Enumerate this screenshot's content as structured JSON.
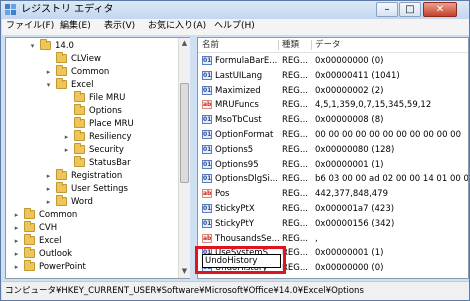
{
  "window": {
    "title": "レジストリ エディタ"
  },
  "menu": [
    "ファイル(F)",
    "編集(E)",
    "表示(V)",
    "お気に入り(A)",
    "ヘルプ(H)"
  ],
  "tree": [
    {
      "label": "14.0",
      "depth": 0,
      "expander": "minus"
    },
    {
      "label": "CLView",
      "depth": 1,
      "expander": ""
    },
    {
      "label": "Common",
      "depth": 1,
      "expander": "plus"
    },
    {
      "label": "Excel",
      "depth": 1,
      "expander": "minus"
    },
    {
      "label": "File MRU",
      "depth": 2,
      "expander": ""
    },
    {
      "label": "Options",
      "depth": 2,
      "expander": ""
    },
    {
      "label": "Place MRU",
      "depth": 2,
      "expander": ""
    },
    {
      "label": "Resiliency",
      "depth": 2,
      "expander": "plus"
    },
    {
      "label": "Security",
      "depth": 2,
      "expander": "plus"
    },
    {
      "label": "StatusBar",
      "depth": 2,
      "expander": ""
    },
    {
      "label": "Registration",
      "depth": 1,
      "expander": "plus"
    },
    {
      "label": "User Settings",
      "depth": 1,
      "expander": "plus"
    },
    {
      "label": "Word",
      "depth": 1,
      "expander": "plus"
    },
    {
      "label": "Common",
      "depth": -1,
      "expander": "plus"
    },
    {
      "label": "CVH",
      "depth": -1,
      "expander": "plus"
    },
    {
      "label": "Excel",
      "depth": -1,
      "expander": "plus"
    },
    {
      "label": "Outlook",
      "depth": -1,
      "expander": "plus"
    },
    {
      "label": "PowerPoint",
      "depth": -1,
      "expander": "plus"
    }
  ],
  "list": {
    "headers": [
      "名前",
      "種類",
      "データ"
    ],
    "rows": [
      {
        "name": "FormulaBarE...",
        "type": "REG...",
        "data": "0x00000000 (0)",
        "icon": "bin"
      },
      {
        "name": "LastUILang",
        "type": "REG...",
        "data": "0x00000411 (1041)",
        "icon": "bin"
      },
      {
        "name": "Maximized",
        "type": "REG...",
        "data": "0x00000002 (2)",
        "icon": "bin"
      },
      {
        "name": "MRUFuncs",
        "type": "REG...",
        "data": "4,5,1,359,0,7,15,345,59,12",
        "icon": "str"
      },
      {
        "name": "MsoTbCust",
        "type": "REG...",
        "data": "0x00000008 (8)",
        "icon": "bin"
      },
      {
        "name": "OptionFormat",
        "type": "REG...",
        "data": "00 00 00 00 00 00 00 00 00 00 00",
        "icon": "bin"
      },
      {
        "name": "Options5",
        "type": "REG...",
        "data": "0x00000080 (128)",
        "icon": "bin"
      },
      {
        "name": "Options95",
        "type": "REG...",
        "data": "0x00000001 (1)",
        "icon": "bin"
      },
      {
        "name": "OptionsDlgSi...",
        "type": "REG...",
        "data": "b6 03 00 00 ad 02 00 00 14 01 00 00",
        "icon": "bin"
      },
      {
        "name": "Pos",
        "type": "REG...",
        "data": "442,377,848,479",
        "icon": "str"
      },
      {
        "name": "StickyPtX",
        "type": "REG...",
        "data": "0x000001a7 (423)",
        "icon": "bin"
      },
      {
        "name": "StickyPtY",
        "type": "REG...",
        "data": "0x00000156 (342)",
        "icon": "bin"
      },
      {
        "name": "ThousandsSe...",
        "type": "REG...",
        "data": ",",
        "icon": "str"
      },
      {
        "name": "UseSystemS...",
        "type": "REG...",
        "data": "0x00000001 (1)",
        "icon": "bin"
      },
      {
        "name": "UndoHistory",
        "type": "REG...",
        "data": "0x00000000 (0)",
        "icon": "bin"
      }
    ],
    "editing_value": "UndoHistory"
  },
  "status": "コンピュータ¥HKEY_CURRENT_USER¥Software¥Microsoft¥Office¥14.0¥Excel¥Options",
  "colors": {
    "highlight_box": "#e0141e",
    "accent": "#5b7ba6"
  }
}
